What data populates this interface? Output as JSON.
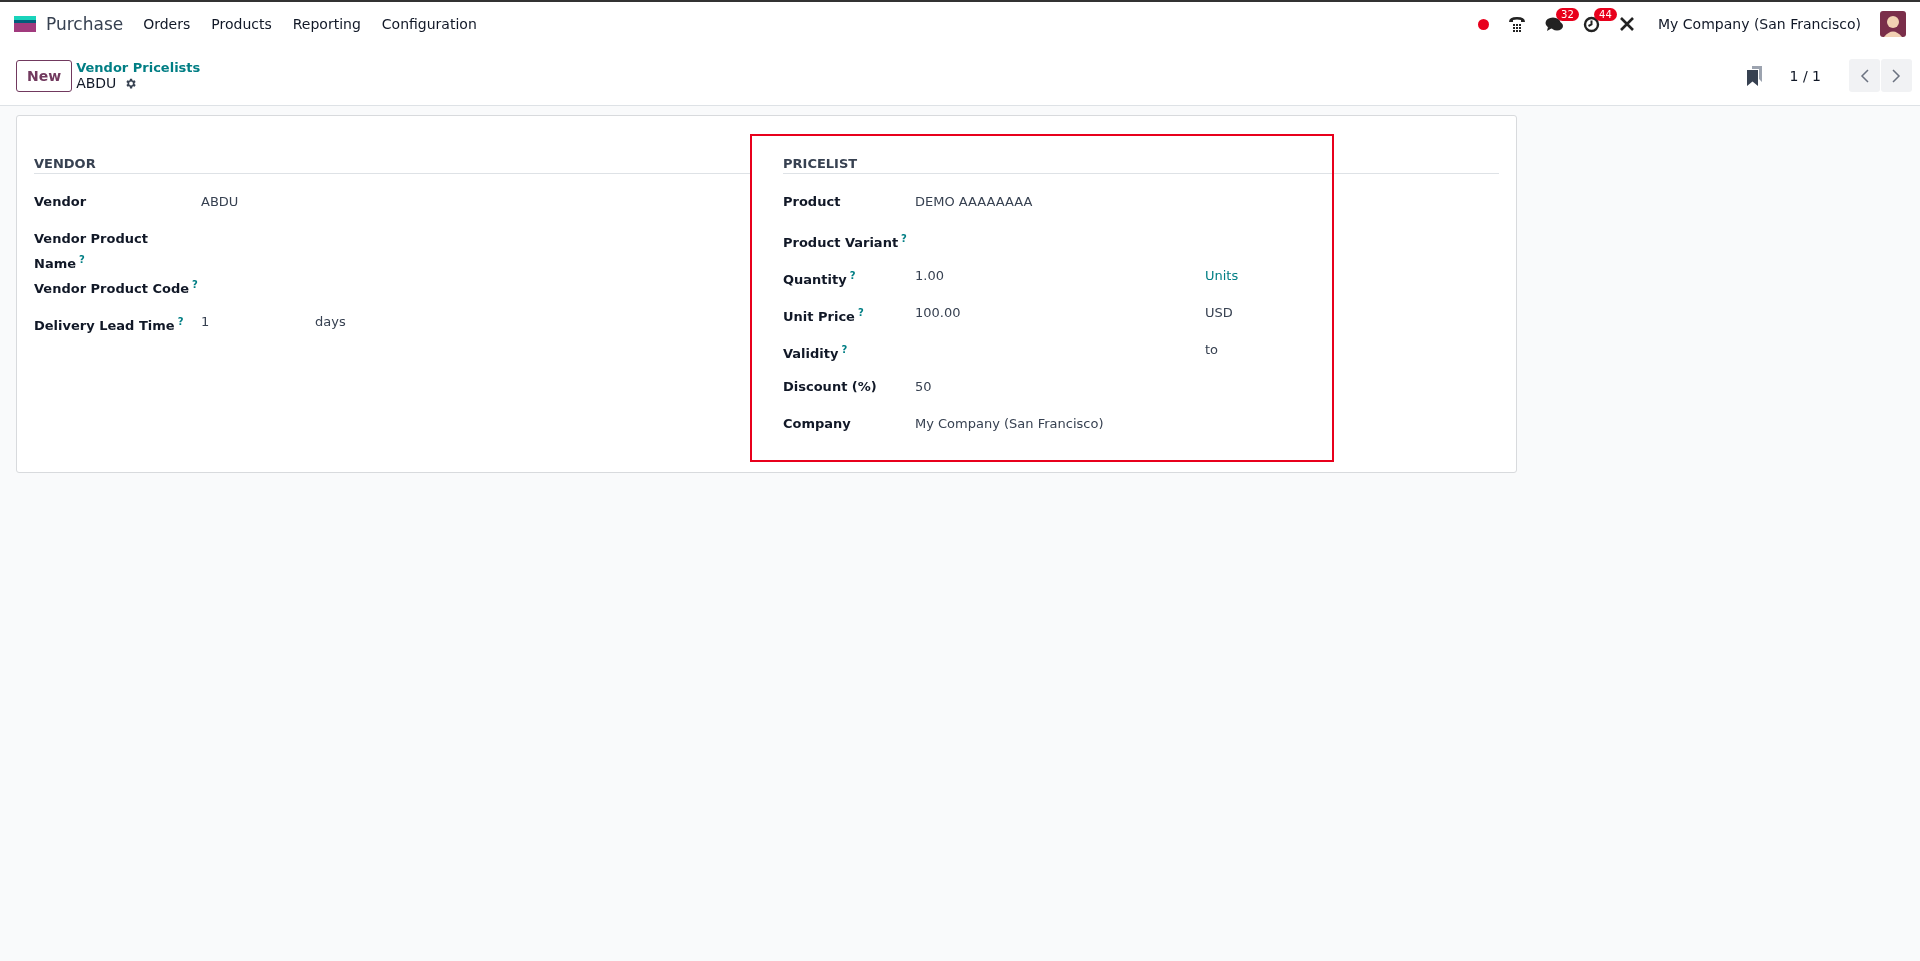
{
  "navbar": {
    "app_name": "Purchase",
    "menu": [
      "Orders",
      "Products",
      "Reporting",
      "Configuration"
    ],
    "messages_badge": "32",
    "activities_badge": "44",
    "company": "My Company (San Francisco)"
  },
  "control_panel": {
    "new_button": "New",
    "breadcrumb": "Vendor Pricelists",
    "record": "ABDU",
    "pager": "1 / 1"
  },
  "groups": [
    {
      "title": "VENDOR",
      "fields": [
        {
          "label": "Vendor",
          "value": "ABDU"
        },
        {
          "label": "Vendor Product Name",
          "help": "?"
        },
        {
          "label": "Vendor Product Code",
          "help": "?"
        },
        {
          "label": "Delivery Lead Time",
          "help": "?",
          "value": "1",
          "suffix": "days",
          "suffix_link": false
        }
      ]
    },
    {
      "title": "PRICELIST",
      "highlighted": true,
      "fields": [
        {
          "label": "Product",
          "value": "DEMO AAAAAAAA"
        },
        {
          "label": "Product Variant",
          "help": "?"
        },
        {
          "label": "Quantity",
          "help": "?",
          "value": "1.00",
          "suffix": "Units",
          "suffix_link": true
        },
        {
          "label": "Unit Price",
          "help": "?",
          "value": "100.00",
          "suffix": "USD",
          "suffix_link": false
        },
        {
          "label": "Validity",
          "help": "?",
          "suffix": "to",
          "suffix_link": false
        },
        {
          "label": "Discount (%)",
          "value": "50"
        },
        {
          "label": "Company",
          "value": "My Company (San Francisco)"
        }
      ]
    }
  ]
}
